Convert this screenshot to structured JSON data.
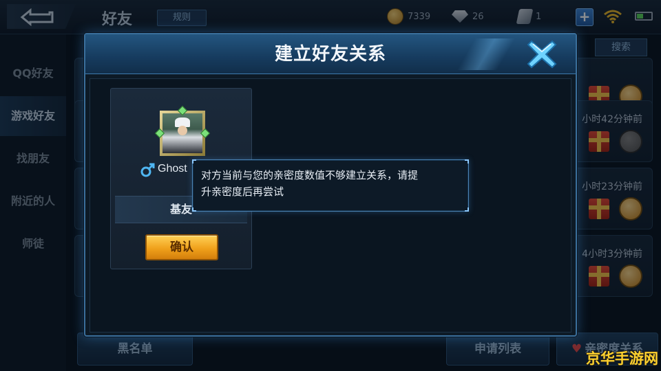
{
  "topbar": {
    "title": "好友",
    "rules_label": "规则",
    "gold": "7339",
    "diamonds": "26",
    "tickets": "1",
    "plus_label": "+"
  },
  "sidebar": {
    "items": [
      {
        "label": "QQ好友",
        "active": false
      },
      {
        "label": "游戏好友",
        "active": true
      },
      {
        "label": "找朋友",
        "active": false
      },
      {
        "label": "附近的人",
        "active": false
      },
      {
        "label": "师徒",
        "active": false
      }
    ]
  },
  "list": {
    "search_label": "搜索",
    "rows": [
      {
        "time": ""
      },
      {
        "time": "小时42分钟前"
      },
      {
        "time": "小时23分钟前"
      },
      {
        "time": "4小时3分钟前"
      }
    ],
    "blacklist_label": "黑名单",
    "requests_label": "申请列表",
    "intimacy_label": "亲密度关系"
  },
  "modal": {
    "title": "建立好友关系",
    "player_name": "Ghost",
    "relation": "基友",
    "confirm_label": "确认",
    "message_line1": "对方当前与您的亲密度数值不够建立关系，请提",
    "message_line2": "升亲密度后再尝试"
  },
  "watermark": "京华手游网",
  "colors": {
    "accent": "#3a6f9c",
    "confirm": "#f0a11b",
    "close": "#6fd3ff",
    "male": "#4fb6f2"
  },
  "icons": [
    "back-icon",
    "gold-coin-icon",
    "diamond-icon",
    "ticket-icon",
    "plus-icon",
    "wifi-icon",
    "battery-icon",
    "close-icon",
    "male-icon",
    "gift-icon",
    "coin-send-icon",
    "heart-icon"
  ]
}
